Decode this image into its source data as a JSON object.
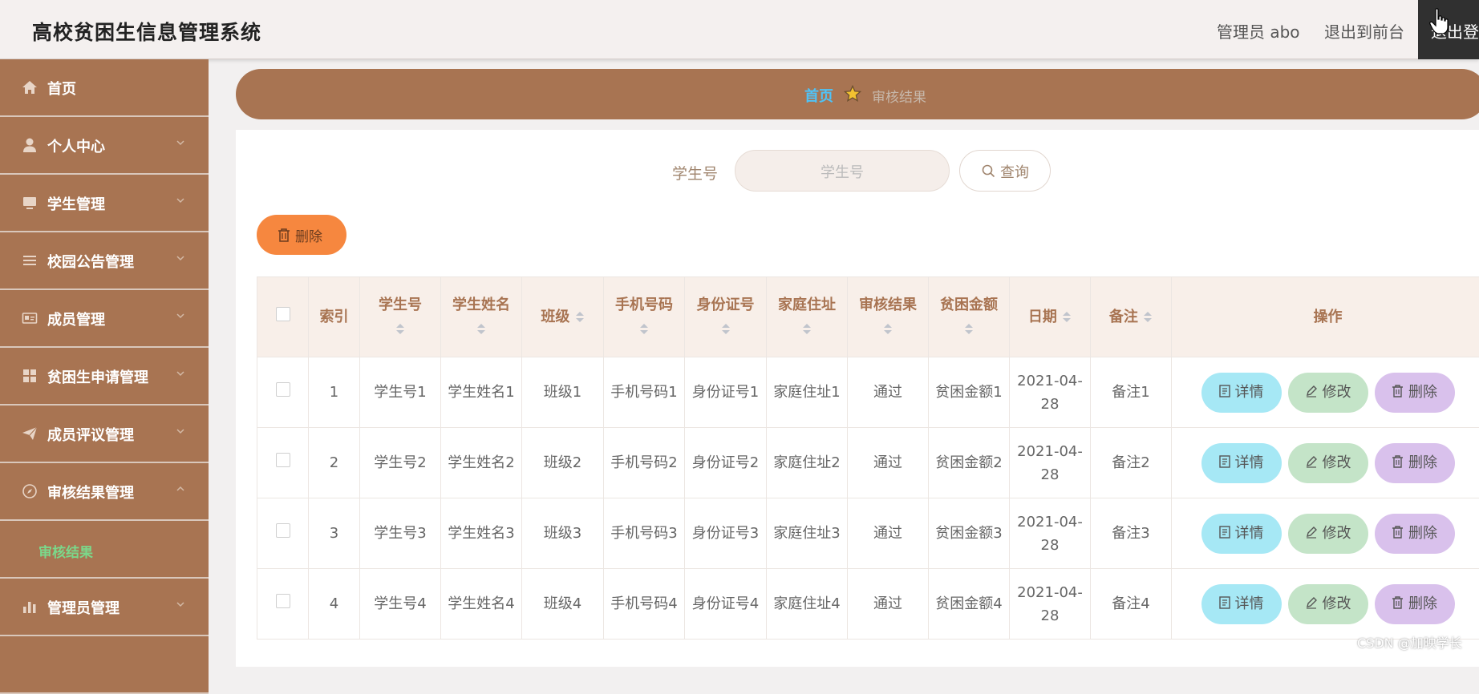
{
  "header": {
    "app_title": "高校贫困生信息管理系统",
    "user_label": "管理员 abo",
    "front_link": "退出到前台",
    "logout_label": "退出登录"
  },
  "sidebar": {
    "items": [
      {
        "label": "首页",
        "icon": "home-icon"
      },
      {
        "label": "个人中心",
        "icon": "user-icon"
      },
      {
        "label": "学生管理",
        "icon": "monitor-icon"
      },
      {
        "label": "校园公告管理",
        "icon": "list-icon"
      },
      {
        "label": "成员管理",
        "icon": "id-card-icon"
      },
      {
        "label": "贫困生申请管理",
        "icon": "grid-icon"
      },
      {
        "label": "成员评议管理",
        "icon": "send-icon"
      },
      {
        "label": "审核结果管理",
        "icon": "compass-icon"
      },
      {
        "label": "管理员管理",
        "icon": "bar-chart-icon"
      }
    ],
    "active_sub": "审核结果"
  },
  "breadcrumb": {
    "home": "首页",
    "current": "审核结果"
  },
  "search": {
    "label": "学生号",
    "placeholder": "学生号",
    "button": "查询"
  },
  "bulk_delete_label": "删除",
  "table": {
    "columns": [
      "索引",
      "学生号",
      "学生姓名",
      "班级",
      "手机号码",
      "身份证号",
      "家庭住址",
      "审核结果",
      "贫困金额",
      "日期",
      "备注",
      "操作"
    ],
    "rows": [
      {
        "index": "1",
        "student_no": "学生号1",
        "name": "学生姓名1",
        "class": "班级1",
        "phone": "手机号码1",
        "id_no": "身份证号1",
        "address": "家庭住址1",
        "result": "通过",
        "amount": "贫困金额1",
        "date": "2021-04-28",
        "remark": "备注1"
      },
      {
        "index": "2",
        "student_no": "学生号2",
        "name": "学生姓名2",
        "class": "班级2",
        "phone": "手机号码2",
        "id_no": "身份证号2",
        "address": "家庭住址2",
        "result": "通过",
        "amount": "贫困金额2",
        "date": "2021-04-28",
        "remark": "备注2"
      },
      {
        "index": "3",
        "student_no": "学生号3",
        "name": "学生姓名3",
        "class": "班级3",
        "phone": "手机号码3",
        "id_no": "身份证号3",
        "address": "家庭住址3",
        "result": "通过",
        "amount": "贫困金额3",
        "date": "2021-04-28",
        "remark": "备注3"
      },
      {
        "index": "4",
        "student_no": "学生号4",
        "name": "学生姓名4",
        "class": "班级4",
        "phone": "手机号码4",
        "id_no": "身份证号4",
        "address": "家庭住址4",
        "result": "通过",
        "amount": "贫困金额4",
        "date": "2021-04-28",
        "remark": "备注4"
      }
    ],
    "actions": {
      "detail": "详情",
      "edit": "修改",
      "delete": "删除"
    }
  },
  "watermark": "CSDN @加映学长",
  "colors": {
    "sidebar_bg": "#a87452",
    "breadcrumb_bg": "#a87452",
    "header_text": "#a87452",
    "active_sub": "#7bd88a",
    "bulk_delete": "#f6873f",
    "detail_btn": "#a6e8f5",
    "edit_btn": "#c4e4c8",
    "delete_btn": "#d9c1ec"
  }
}
